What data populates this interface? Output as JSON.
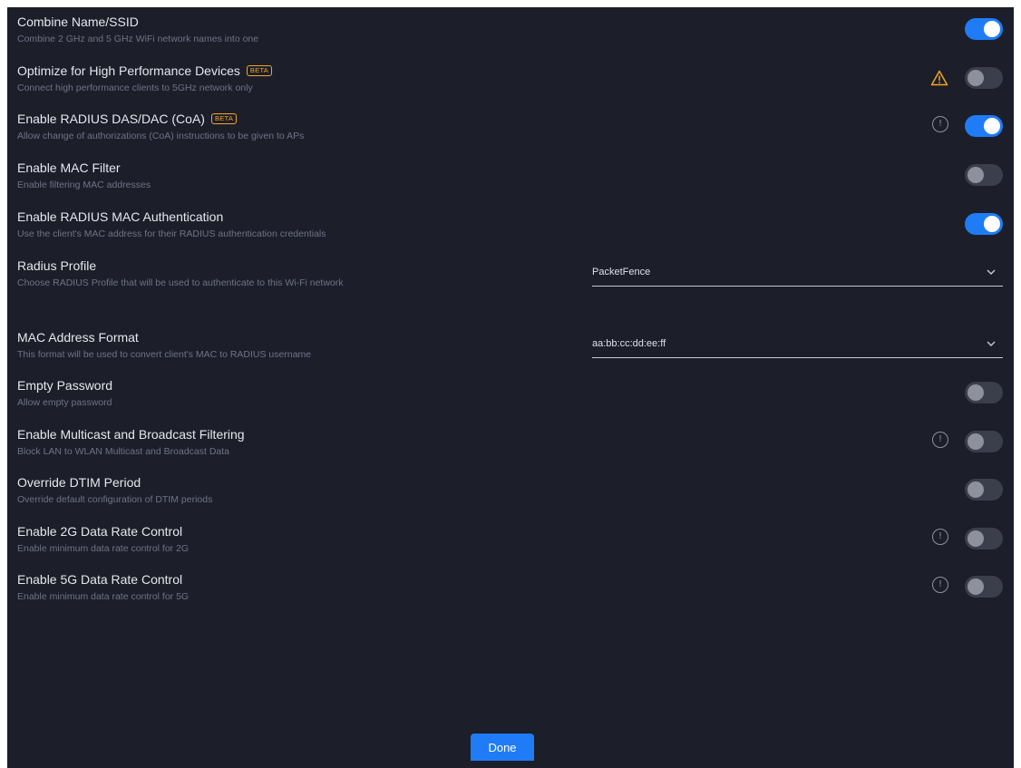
{
  "settings": [
    {
      "title": "Combine Name/SSID",
      "desc": "Combine 2 GHz and 5 GHz WiFi network names into one",
      "on": true
    },
    {
      "title": "Optimize for High Performance Devices",
      "badge": "BETA",
      "desc": "Connect high performance clients to 5GHz network only",
      "on": false,
      "icon": "warning-icon"
    },
    {
      "title": "Enable RADIUS DAS/DAC (CoA)",
      "badge": "BETA",
      "desc": "Allow change of authorizations (CoA) instructions to be given to APs",
      "on": true,
      "icon": "info-icon"
    },
    {
      "title": "Enable MAC Filter",
      "desc": "Enable filtering MAC addresses",
      "on": false
    },
    {
      "title": "Enable RADIUS MAC Authentication",
      "desc": "Use the client's MAC address for their RADIUS authentication credentials",
      "on": true
    },
    {
      "title": "Radius Profile",
      "desc": "Choose RADIUS Profile that will be used to authenticate to this Wi-Fi network",
      "select_value": "PacketFence"
    },
    {
      "title": "MAC Address Format",
      "desc": "This format will be used to convert client's MAC to RADIUS username",
      "select_value": "aa:bb:cc:dd:ee:ff"
    },
    {
      "title": "Empty Password",
      "desc": "Allow empty password",
      "on": false
    },
    {
      "title": "Enable Multicast and Broadcast Filtering",
      "desc": "Block LAN to WLAN Multicast and Broadcast Data",
      "on": false,
      "icon": "info-icon"
    },
    {
      "title": "Override DTIM Period",
      "desc": "Override default configuration of DTIM periods",
      "on": false
    },
    {
      "title": "Enable 2G Data Rate Control",
      "desc": "Enable minimum data rate control for 2G",
      "on": false,
      "icon": "info-icon"
    },
    {
      "title": "Enable 5G Data Rate Control",
      "desc": "Enable minimum data rate control for 5G",
      "on": false,
      "icon": "info-icon"
    }
  ],
  "info_glyph": "!",
  "done_label": "Done",
  "colors": {
    "accent": "#1f7cf6",
    "warning": "#f5a524",
    "background": "#1c1e2a"
  }
}
